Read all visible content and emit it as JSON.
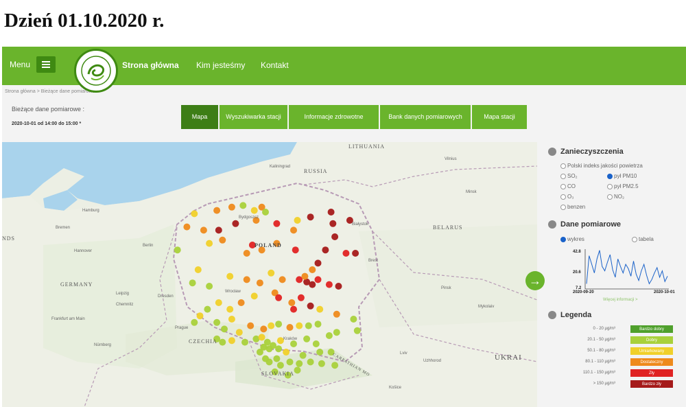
{
  "page_heading": "Dzień 01.10.2020 r.",
  "header": {
    "menu_label": "Menu",
    "nav": [
      "Strona główna",
      "Kim jesteśmy",
      "Kontakt"
    ]
  },
  "breadcrumb": "Strona główna  >  Bieżące dane pomiarowe",
  "current": {
    "label": "Bieżące dane pomiarowe :",
    "range": "2020-10-01 od 14:00 do 15:00 *"
  },
  "tabs": [
    "Mapa",
    "Wyszukiwarka stacji",
    "Informacje zdrowotne",
    "Bank danych pomiarowych",
    "Mapa stacji"
  ],
  "map": {
    "countries": [
      "LITHUANIA",
      "RUSSIA",
      "BELARUS",
      "POLAND",
      "GERMANY",
      "CZECHIA",
      "SLOVAKIA",
      "UKRAI",
      "NDS",
      "CARPATHIAN MO"
    ],
    "cities": [
      "Kaliningrad",
      "Vilnius",
      "Minsk",
      "Hamburg",
      "Berlin",
      "Hannover",
      "Bremen",
      "Leipzig",
      "Dresden",
      "Prague",
      "Brest",
      "Lviv",
      "Kraków",
      "Wrocław",
      "Bydgoszcz",
      "Białystok",
      "Pinsk",
      "Chemnitz",
      "Frankfurt am Main",
      "Košice",
      "Uzhhorod",
      "Mykolaiv",
      "Nürnberg"
    ]
  },
  "panel": {
    "pollutants_title": "Zanieczyszczenia",
    "index_label": "Polski indeks jakości powietrza",
    "options": [
      "SO₂",
      "pył PM10",
      "CO",
      "pył PM2.5",
      "O₃",
      "NO₂",
      "benzen"
    ],
    "selected_option": "pył PM10",
    "measurements_title": "Dane pomiarowe",
    "view_options": [
      "wykres",
      "tabela"
    ],
    "selected_view": "wykres",
    "chart_more": "Więcej informacji >",
    "legend_title": "Legenda",
    "legend": [
      {
        "range": "0 - 20 µg/m³",
        "label": "Bardzo dobry",
        "color": "#4fa02c"
      },
      {
        "range": "20.1 - 50 µg/m³",
        "label": "Dobry",
        "color": "#a9d13b"
      },
      {
        "range": "50.1 - 80 µg/m³",
        "label": "Umiarkowany",
        "color": "#f0d02a"
      },
      {
        "range": "80.1 - 110 µg/m³",
        "label": "Dostateczny",
        "color": "#ee8a1c"
      },
      {
        "range": "110.1 - 150 µg/m³",
        "label": "Zły",
        "color": "#e02323"
      },
      {
        "range": "> 150 µg/m³",
        "label": "Bardzo zły",
        "color": "#a51a1a"
      }
    ]
  },
  "chart_data": {
    "type": "line",
    "series": [
      {
        "values": [
          12,
          38,
          30,
          22,
          35,
          43,
          28,
          24,
          32,
          39,
          25,
          18,
          35,
          28,
          22,
          30,
          26,
          19,
          33,
          21,
          15,
          24,
          30,
          20,
          12,
          16,
          22,
          27,
          18,
          24,
          14,
          19
        ]
      }
    ],
    "x_ticks": [
      "2020-09-20",
      "2020-10-01"
    ],
    "y_ticks": [
      "42.8",
      "20.6",
      "7.2"
    ],
    "ylim": [
      7.2,
      42.8
    ],
    "color": "#1a62c9"
  },
  "stations": [
    {
      "lon": 15.0,
      "lat": 54.3,
      "cat": 2
    },
    {
      "lon": 16.2,
      "lat": 54.4,
      "cat": 3
    },
    {
      "lon": 17.0,
      "lat": 54.5,
      "cat": 3
    },
    {
      "lon": 17.6,
      "lat": 54.55,
      "cat": 1
    },
    {
      "lon": 18.2,
      "lat": 54.4,
      "cat": 2
    },
    {
      "lon": 18.6,
      "lat": 54.5,
      "cat": 3
    },
    {
      "lon": 18.8,
      "lat": 54.35,
      "cat": 1
    },
    {
      "lon": 18.3,
      "lat": 54.1,
      "cat": 3
    },
    {
      "lon": 17.2,
      "lat": 54.0,
      "cat": 5
    },
    {
      "lon": 16.3,
      "lat": 53.8,
      "cat": 5
    },
    {
      "lon": 15.5,
      "lat": 53.8,
      "cat": 3
    },
    {
      "lon": 14.6,
      "lat": 53.9,
      "cat": 3
    },
    {
      "lon": 20.5,
      "lat": 54.1,
      "cat": 2
    },
    {
      "lon": 21.2,
      "lat": 54.2,
      "cat": 5
    },
    {
      "lon": 22.4,
      "lat": 54.0,
      "cat": 5
    },
    {
      "lon": 23.3,
      "lat": 54.1,
      "cat": 5
    },
    {
      "lon": 22.3,
      "lat": 54.35,
      "cat": 5
    },
    {
      "lon": 20.3,
      "lat": 53.8,
      "cat": 3
    },
    {
      "lon": 19.4,
      "lat": 54.0,
      "cat": 4
    },
    {
      "lon": 22.5,
      "lat": 53.6,
      "cat": 5
    },
    {
      "lon": 23.1,
      "lat": 53.1,
      "cat": 4
    },
    {
      "lon": 23.6,
      "lat": 53.1,
      "cat": 5
    },
    {
      "lon": 22.0,
      "lat": 53.2,
      "cat": 5
    },
    {
      "lon": 21.6,
      "lat": 52.8,
      "cat": 5
    },
    {
      "lon": 14.1,
      "lat": 53.2,
      "cat": 1
    },
    {
      "lon": 15.8,
      "lat": 53.4,
      "cat": 2
    },
    {
      "lon": 16.5,
      "lat": 53.5,
      "cat": 3
    },
    {
      "lon": 17.8,
      "lat": 53.1,
      "cat": 3
    },
    {
      "lon": 18.6,
      "lat": 53.2,
      "cat": 3
    },
    {
      "lon": 19.4,
      "lat": 53.4,
      "cat": 3
    },
    {
      "lon": 18.1,
      "lat": 53.35,
      "cat": 4
    },
    {
      "lon": 20.4,
      "lat": 53.2,
      "cat": 4
    },
    {
      "lon": 15.2,
      "lat": 52.6,
      "cat": 2
    },
    {
      "lon": 14.9,
      "lat": 52.2,
      "cat": 1
    },
    {
      "lon": 15.8,
      "lat": 52.1,
      "cat": 1
    },
    {
      "lon": 16.9,
      "lat": 52.4,
      "cat": 2
    },
    {
      "lon": 17.8,
      "lat": 52.3,
      "cat": 3
    },
    {
      "lon": 18.5,
      "lat": 52.2,
      "cat": 3
    },
    {
      "lon": 19.1,
      "lat": 52.5,
      "cat": 2
    },
    {
      "lon": 19.7,
      "lat": 52.3,
      "cat": 3
    },
    {
      "lon": 20.6,
      "lat": 52.3,
      "cat": 4
    },
    {
      "lon": 21.0,
      "lat": 52.23,
      "cat": 5
    },
    {
      "lon": 21.3,
      "lat": 52.15,
      "cat": 5
    },
    {
      "lon": 21.6,
      "lat": 52.3,
      "cat": 4
    },
    {
      "lon": 20.9,
      "lat": 52.4,
      "cat": 3
    },
    {
      "lon": 22.2,
      "lat": 52.15,
      "cat": 4
    },
    {
      "lon": 22.7,
      "lat": 52.1,
      "cat": 5
    },
    {
      "lon": 21.3,
      "lat": 52.6,
      "cat": 3
    },
    {
      "lon": 16.3,
      "lat": 51.6,
      "cat": 2
    },
    {
      "lon": 15.7,
      "lat": 51.4,
      "cat": 1
    },
    {
      "lon": 15.3,
      "lat": 51.2,
      "cat": 2
    },
    {
      "lon": 16.9,
      "lat": 51.4,
      "cat": 2
    },
    {
      "lon": 17.5,
      "lat": 51.6,
      "cat": 3
    },
    {
      "lon": 18.2,
      "lat": 51.8,
      "cat": 2
    },
    {
      "lon": 19.3,
      "lat": 51.9,
      "cat": 3
    },
    {
      "lon": 19.5,
      "lat": 51.75,
      "cat": 4
    },
    {
      "lon": 20.2,
      "lat": 51.6,
      "cat": 3
    },
    {
      "lon": 20.3,
      "lat": 51.4,
      "cat": 4
    },
    {
      "lon": 20.7,
      "lat": 51.75,
      "cat": 4
    },
    {
      "lon": 21.2,
      "lat": 51.5,
      "cat": 5
    },
    {
      "lon": 21.7,
      "lat": 51.4,
      "cat": 2
    },
    {
      "lon": 22.6,
      "lat": 51.25,
      "cat": 3
    },
    {
      "lon": 23.5,
      "lat": 51.1,
      "cat": 1
    },
    {
      "lon": 17.0,
      "lat": 51.1,
      "cat": 2
    },
    {
      "lon": 16.2,
      "lat": 51.0,
      "cat": 1
    },
    {
      "lon": 15.0,
      "lat": 51.0,
      "cat": 1
    },
    {
      "lon": 16.6,
      "lat": 50.8,
      "cat": 1
    },
    {
      "lon": 17.4,
      "lat": 50.7,
      "cat": 2
    },
    {
      "lon": 18.0,
      "lat": 50.9,
      "cat": 3
    },
    {
      "lon": 18.7,
      "lat": 50.8,
      "cat": 3
    },
    {
      "lon": 19.1,
      "lat": 50.9,
      "cat": 2
    },
    {
      "lon": 19.5,
      "lat": 50.95,
      "cat": 1
    },
    {
      "lon": 20.1,
      "lat": 50.85,
      "cat": 3
    },
    {
      "lon": 20.6,
      "lat": 50.9,
      "cat": 2
    },
    {
      "lon": 21.1,
      "lat": 50.9,
      "cat": 1
    },
    {
      "lon": 21.6,
      "lat": 50.95,
      "cat": 1
    },
    {
      "lon": 22.6,
      "lat": 50.7,
      "cat": 1
    },
    {
      "lon": 23.7,
      "lat": 50.75,
      "cat": 1
    },
    {
      "lon": 16.2,
      "lat": 50.5,
      "cat": 1
    },
    {
      "lon": 16.5,
      "lat": 50.4,
      "cat": 1
    },
    {
      "lon": 17.0,
      "lat": 50.45,
      "cat": 2
    },
    {
      "lon": 17.7,
      "lat": 50.4,
      "cat": 1
    },
    {
      "lon": 18.3,
      "lat": 50.5,
      "cat": 1
    },
    {
      "lon": 18.6,
      "lat": 50.55,
      "cat": 2
    },
    {
      "lon": 18.9,
      "lat": 50.4,
      "cat": 1
    },
    {
      "lon": 19.2,
      "lat": 50.3,
      "cat": 1
    },
    {
      "lon": 19.0,
      "lat": 50.2,
      "cat": 1
    },
    {
      "lon": 18.7,
      "lat": 50.25,
      "cat": 1
    },
    {
      "lon": 18.5,
      "lat": 50.1,
      "cat": 1
    },
    {
      "lon": 19.5,
      "lat": 50.2,
      "cat": 1
    },
    {
      "lon": 19.9,
      "lat": 50.1,
      "cat": 2
    },
    {
      "lon": 19.6,
      "lat": 50.45,
      "cat": 2
    },
    {
      "lon": 20.3,
      "lat": 50.35,
      "cat": 1
    },
    {
      "lon": 21.0,
      "lat": 50.5,
      "cat": 1
    },
    {
      "lon": 21.5,
      "lat": 50.35,
      "cat": 1
    },
    {
      "lon": 22.2,
      "lat": 50.6,
      "cat": 1
    },
    {
      "lon": 22.3,
      "lat": 50.1,
      "cat": 1
    },
    {
      "lon": 21.7,
      "lat": 50.1,
      "cat": 1
    },
    {
      "lon": 20.8,
      "lat": 50.0,
      "cat": 1
    },
    {
      "lon": 19.0,
      "lat": 49.8,
      "cat": 1
    },
    {
      "lon": 18.8,
      "lat": 49.9,
      "cat": 1
    },
    {
      "lon": 19.4,
      "lat": 49.9,
      "cat": 1
    },
    {
      "lon": 19.6,
      "lat": 49.7,
      "cat": 1
    },
    {
      "lon": 20.1,
      "lat": 49.8,
      "cat": 1
    },
    {
      "lon": 20.6,
      "lat": 49.75,
      "cat": 1
    },
    {
      "lon": 21.2,
      "lat": 49.8,
      "cat": 1
    },
    {
      "lon": 21.8,
      "lat": 49.75,
      "cat": 1
    },
    {
      "lon": 22.5,
      "lat": 49.7,
      "cat": 1
    },
    {
      "lon": 20.0,
      "lat": 49.4,
      "cat": 1
    },
    {
      "lon": 19.3,
      "lat": 49.5,
      "cat": 1
    },
    {
      "lon": 20.5,
      "lat": 49.55,
      "cat": 1
    }
  ]
}
